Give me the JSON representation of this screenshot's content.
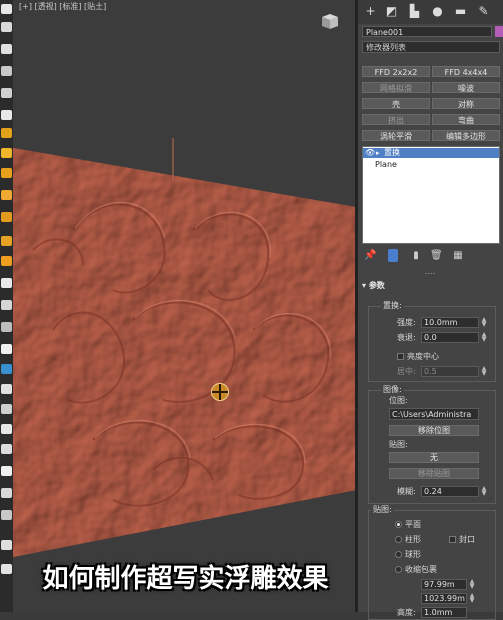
{
  "viewport": {
    "label": "[+] [透视] [标准] [贴土]",
    "caption": "如何制作超写实浮雕效果"
  },
  "panel": {
    "object_name": "Plane001",
    "object_color": "#b35cb8",
    "modifier_list": "修改器列表",
    "buttons": [
      {
        "label": "FFD 2x2x2",
        "enabled": true
      },
      {
        "label": "FFD 4x4x4",
        "enabled": true
      },
      {
        "label": "网格拟滑",
        "enabled": false
      },
      {
        "label": "噪波",
        "enabled": true
      },
      {
        "label": "壳",
        "enabled": true
      },
      {
        "label": "对称",
        "enabled": true
      },
      {
        "label": "挤出",
        "enabled": false
      },
      {
        "label": "弯曲",
        "enabled": true
      },
      {
        "label": "涡轮平滑",
        "enabled": true
      },
      {
        "label": "编辑多边形",
        "enabled": true
      }
    ],
    "stack": {
      "selected_modifier": "置换",
      "base_object": "Plane"
    },
    "params": {
      "header": "参数",
      "displace": {
        "title": "置换:",
        "strength_label": "强度:",
        "strength_value": "10.0mm",
        "decay_label": "衰退:",
        "decay_value": "0.0",
        "luminance_center_label": "亮度中心",
        "center_label": "居中:",
        "center_value": "0.5"
      },
      "image": {
        "title": "图像:",
        "bitmap_label": "位图:",
        "bitmap_path": "C:\\Users\\Administra",
        "remove_bitmap": "移除位图",
        "map_label": "贴图:",
        "map_value": "无",
        "remove_map": "移除贴图",
        "blur_label": "模糊:",
        "blur_value": "0.24"
      },
      "map": {
        "title": "贴图:",
        "planar": "平面",
        "cylindrical": "柱形",
        "cap": "封口",
        "spherical": "球形",
        "shrink_wrap": "收缩包裹",
        "length_value": "97.99m",
        "width_value": "1023.99m",
        "height_label": "高度:",
        "height_value": "1.0mm"
      }
    }
  }
}
